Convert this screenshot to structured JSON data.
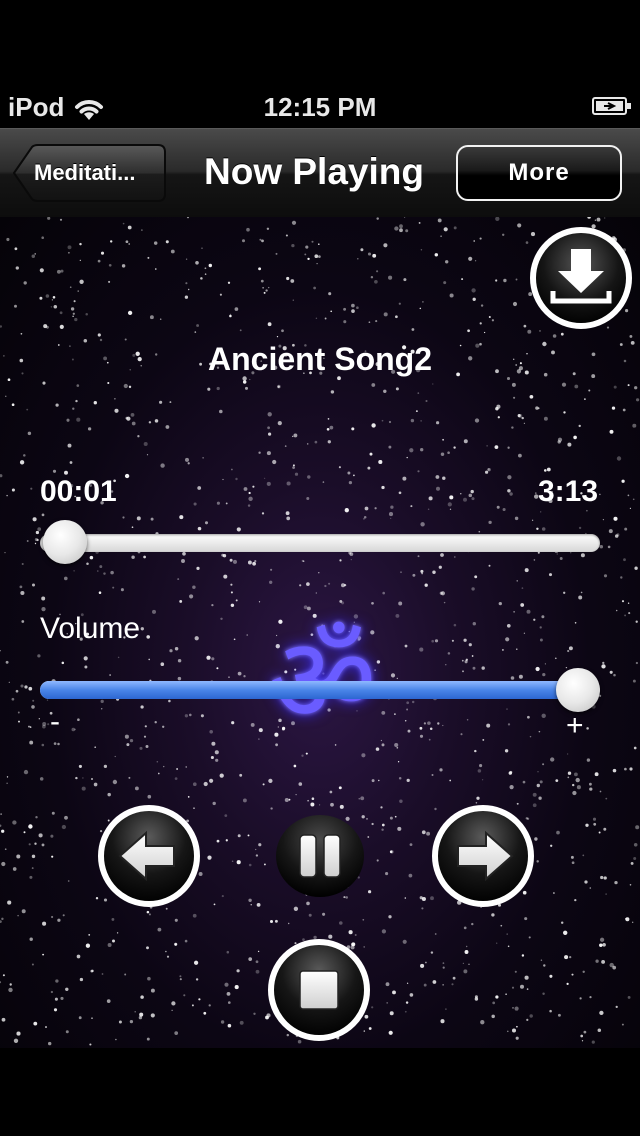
{
  "status_bar": {
    "carrier": "iPod",
    "time": "12:15 PM",
    "wifi_icon": "wifi-icon",
    "battery_icon": "battery-icon"
  },
  "nav": {
    "back_label": "Meditati...",
    "title": "Now Playing",
    "more_label": "More"
  },
  "player": {
    "song_title": "Ancient Song2",
    "elapsed": "00:01",
    "total": "3:13",
    "progress_fraction": 0.005,
    "volume_label": "Volume",
    "volume_min": "-",
    "volume_max": "+",
    "volume_fraction": 1.0
  },
  "icons": {
    "download": "download-icon",
    "previous": "arrow-left-icon",
    "pause": "pause-icon",
    "next": "arrow-right-icon",
    "stop": "stop-icon",
    "background": "om-symbol-icon"
  },
  "colors": {
    "volume_fill": "#4a85e8",
    "om_glyph": "#6a5cff",
    "background": "#1a0d28"
  }
}
